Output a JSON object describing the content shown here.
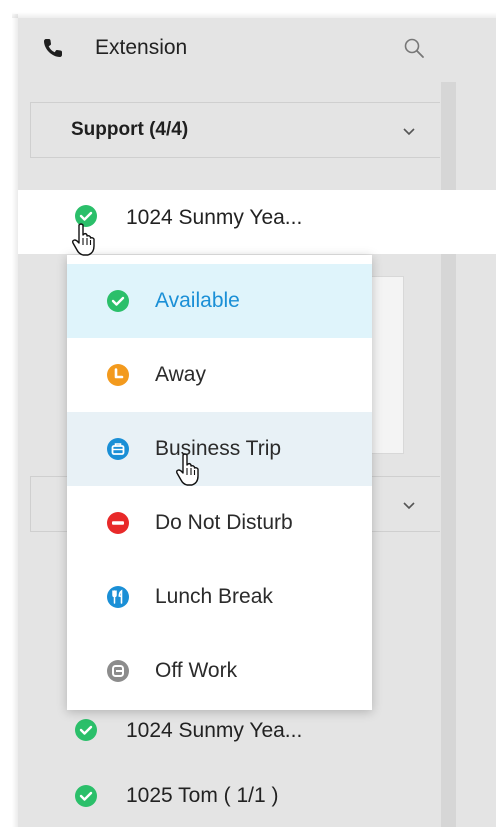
{
  "header": {
    "title": "Extension",
    "phone_icon": "phone-icon",
    "search_icon": "search-icon"
  },
  "groups": [
    {
      "title": "Support (4/4)",
      "collapsed": false
    },
    {
      "title": "",
      "collapsed": true
    }
  ],
  "rows": {
    "selected": {
      "label": "1024 Sunmy Yea...",
      "status": "available"
    },
    "lower1": {
      "label": "1024 Sunmy Yea...",
      "status": "available"
    },
    "lower2": {
      "label": "1025 Tom ( 1/1 )",
      "status": "available"
    }
  },
  "status_menu": {
    "items": [
      {
        "label": "Available",
        "icon": "available-check-icon",
        "color": "#2bbf6a",
        "selected": true
      },
      {
        "label": "Away",
        "icon": "away-clock-icon",
        "color": "#f39a1d"
      },
      {
        "label": "Business Trip",
        "icon": "business-trip-suitcase-icon",
        "color": "#1a8fd6",
        "hovered": true
      },
      {
        "label": "Do Not Disturb",
        "icon": "do-not-disturb-icon",
        "color": "#e82929"
      },
      {
        "label": "Lunch Break",
        "icon": "lunch-break-cutlery-icon",
        "color": "#1a8fd6"
      },
      {
        "label": "Off Work",
        "icon": "off-work-icon",
        "color": "#8c8c8c"
      }
    ]
  },
  "colors": {
    "accent": "#1a8fd6",
    "available": "#2bbf6a"
  }
}
